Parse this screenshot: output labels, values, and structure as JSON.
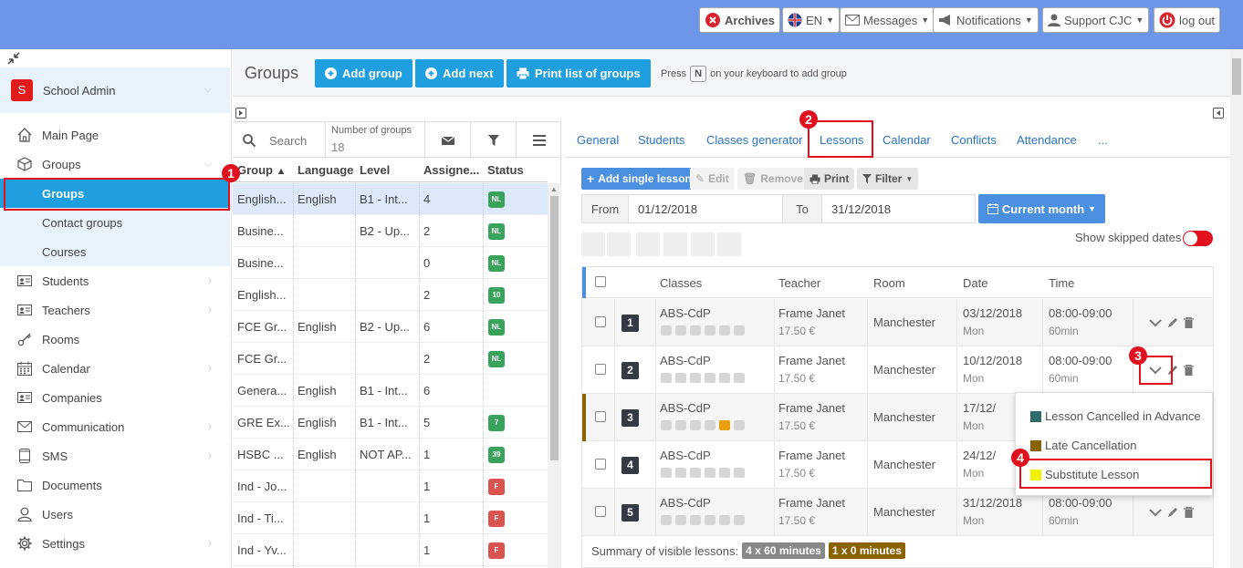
{
  "topbar": {
    "archives": "Archives",
    "lang": "EN",
    "messages": "Messages",
    "notifications": "Notifications",
    "support": "Support CJC",
    "logout": "log out"
  },
  "sidebar": {
    "account": {
      "avatar": "S",
      "name": "School Admin"
    },
    "items": [
      {
        "label": "Main Page",
        "icon": "home-icon"
      },
      {
        "label": "Groups",
        "icon": "cube-icon"
      },
      {
        "label": "Groups",
        "icon": ""
      },
      {
        "label": "Contact groups",
        "icon": ""
      },
      {
        "label": "Courses",
        "icon": ""
      },
      {
        "label": "Students",
        "icon": "id-card-icon"
      },
      {
        "label": "Teachers",
        "icon": "id-card-icon"
      },
      {
        "label": "Rooms",
        "icon": "key-icon"
      },
      {
        "label": "Calendar",
        "icon": "calendar-icon"
      },
      {
        "label": "Companies",
        "icon": "id-card-icon"
      },
      {
        "label": "Communication",
        "icon": "envelope-icon"
      },
      {
        "label": "SMS",
        "icon": "phone-icon"
      },
      {
        "label": "Documents",
        "icon": "folder-icon"
      },
      {
        "label": "Users",
        "icon": "user-icon"
      },
      {
        "label": "Settings",
        "icon": "gear-icon"
      }
    ]
  },
  "header": {
    "title": "Groups",
    "add_group": "Add group",
    "add_next": "Add next",
    "print_list": "Print list of groups",
    "hint_before": "Press",
    "hint_key": "N",
    "hint_after": "on your keyboard to add group"
  },
  "groups_panel": {
    "search_placeholder": "Search",
    "count_label": "Number of groups",
    "count": "18",
    "columns": [
      "Group",
      "Language",
      "Level",
      "Assigne...",
      "Status"
    ],
    "rows": [
      {
        "group": "English...",
        "language": "English",
        "level": "B1 - Int...",
        "assigned": "4",
        "status": "NL",
        "status_color": "#3aa35b"
      },
      {
        "group": "Busine...",
        "language": "",
        "level": "B2 - Up...",
        "assigned": "2",
        "status": "NL",
        "status_color": "#3aa35b"
      },
      {
        "group": "Busine...",
        "language": "",
        "level": "",
        "assigned": "0",
        "status": "NL",
        "status_color": "#3aa35b"
      },
      {
        "group": "English...",
        "language": "",
        "level": "",
        "assigned": "2",
        "status": "10",
        "status_color": "#3aa35b"
      },
      {
        "group": "FCE Gr...",
        "language": "English",
        "level": "B2 - Up...",
        "assigned": "6",
        "status": "NL",
        "status_color": "#3aa35b"
      },
      {
        "group": "FCE Gr...",
        "language": "",
        "level": "",
        "assigned": "2",
        "status": "NL",
        "status_color": "#3aa35b"
      },
      {
        "group": "Genera...",
        "language": "English",
        "level": "B1 - Int...",
        "assigned": "6",
        "status": "",
        "status_color": ""
      },
      {
        "group": "GRE Ex...",
        "language": "English",
        "level": "B1 - Int...",
        "assigned": "5",
        "status": "7",
        "status_color": "#3aa35b"
      },
      {
        "group": "HSBC ...",
        "language": "English",
        "level": "NOT AP...",
        "assigned": "1",
        "status": "39",
        "status_color": "#3aa35b"
      },
      {
        "group": "Ind - Jo...",
        "language": "",
        "level": "",
        "assigned": "1",
        "status": "F",
        "status_color": "#d9534f"
      },
      {
        "group": "Ind - Ti...",
        "language": "",
        "level": "",
        "assigned": "1",
        "status": "F",
        "status_color": "#d9534f"
      },
      {
        "group": "Ind - Yv...",
        "language": "",
        "level": "",
        "assigned": "1",
        "status": "F",
        "status_color": "#d9534f"
      }
    ]
  },
  "tabs": [
    "General",
    "Students",
    "Classes generator",
    "Lessons",
    "Calendar",
    "Conflicts",
    "Attendance",
    "..."
  ],
  "lessons": {
    "add_single": "Add single lesson",
    "edit": "Edit",
    "remove": "Remove",
    "print": "Print",
    "filter": "Filter",
    "from_label": "From",
    "from_value": "01/12/2018",
    "to_label": "To",
    "to_value": "31/12/2018",
    "current_month": "Current month",
    "show_skipped": "Show skipped dates",
    "columns": [
      "Classes",
      "Teacher",
      "Room",
      "Date",
      "Time"
    ],
    "rows": [
      {
        "num": "1",
        "cls": "ABS-CdP",
        "teacher": "Frame Janet",
        "price": "17.50 €",
        "room": "Manchester",
        "date": "03/12/2018",
        "day": "Mon",
        "time": "08:00-09:00",
        "dur": "60min",
        "stripe": ""
      },
      {
        "num": "2",
        "cls": "ABS-CdP",
        "teacher": "Frame Janet",
        "price": "17.50 €",
        "room": "Manchester",
        "date": "10/12/2018",
        "day": "Mon",
        "time": "08:00-09:00",
        "dur": "60min",
        "stripe": ""
      },
      {
        "num": "3",
        "cls": "ABS-CdP",
        "teacher": "Frame Janet",
        "price": "17.50 €",
        "room": "Manchester",
        "date": "17/12/",
        "day": "Mon",
        "time": "",
        "dur": "",
        "stripe": "#8a6300"
      },
      {
        "num": "4",
        "cls": "ABS-CdP",
        "teacher": "Frame Janet",
        "price": "17.50 €",
        "room": "Manchester",
        "date": "24/12/",
        "day": "Mon",
        "time": "",
        "dur": "",
        "stripe": ""
      },
      {
        "num": "5",
        "cls": "ABS-CdP",
        "teacher": "Frame Janet",
        "price": "17.50 €",
        "room": "Manchester",
        "date": "31/12/2018",
        "day": "Mon",
        "time": "08:00-09:00",
        "dur": "60min",
        "stripe": ""
      }
    ],
    "summary_label": "Summary of visible lessons:",
    "summary_badge1": "4 x 60 minutes",
    "summary_badge2": "1 x 0 minutes"
  },
  "dropdown": {
    "items": [
      {
        "label": "Lesson Cancelled in Advance",
        "color": "#2e6b6b"
      },
      {
        "label": "Late Cancellation",
        "color": "#8a6300"
      },
      {
        "label": "Substitute Lesson",
        "color": "#f0f000"
      }
    ]
  },
  "annotations": [
    "1",
    "2",
    "3",
    "4"
  ]
}
